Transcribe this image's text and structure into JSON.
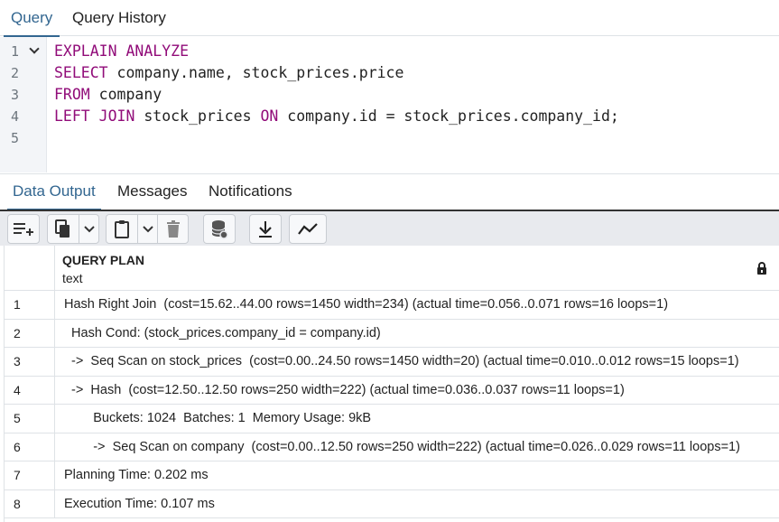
{
  "top_tabs": [
    {
      "label": "Query",
      "active": true
    },
    {
      "label": "Query History",
      "active": false
    }
  ],
  "editor": {
    "line_numbers": [
      "1",
      "2",
      "3",
      "4",
      "5"
    ],
    "lines": [
      [
        {
          "t": "EXPLAIN ANALYZE",
          "k": true
        }
      ],
      [
        {
          "t": "SELECT",
          "k": true
        },
        {
          "t": " company.name, stock_prices.price",
          "k": false
        }
      ],
      [
        {
          "t": "FROM",
          "k": true
        },
        {
          "t": " company",
          "k": false
        }
      ],
      [
        {
          "t": "LEFT JOIN",
          "k": true
        },
        {
          "t": " stock_prices ",
          "k": false
        },
        {
          "t": "ON",
          "k": true
        },
        {
          "t": " company.id = stock_prices.company_id;",
          "k": false
        }
      ],
      []
    ]
  },
  "output_tabs": [
    {
      "label": "Data Output",
      "active": true
    },
    {
      "label": "Messages",
      "active": false
    },
    {
      "label": "Notifications",
      "active": false
    }
  ],
  "toolbar": {
    "icons": [
      "add-row-icon",
      "copy-icon",
      "chevron-down-icon",
      "paste-icon",
      "chevron-down-icon",
      "delete-icon",
      "save-data-icon",
      "download-icon",
      "graph-icon"
    ]
  },
  "grid": {
    "column": {
      "name": "QUERY PLAN",
      "type": "text"
    },
    "rows": [
      {
        "n": "1",
        "v": "Hash Right Join  (cost=15.62..44.00 rows=1450 width=234) (actual time=0.056..0.071 rows=16 loops=1)"
      },
      {
        "n": "2",
        "v": "  Hash Cond: (stock_prices.company_id = company.id)"
      },
      {
        "n": "3",
        "v": "  ->  Seq Scan on stock_prices  (cost=0.00..24.50 rows=1450 width=20) (actual time=0.010..0.012 rows=15 loops=1)"
      },
      {
        "n": "4",
        "v": "  ->  Hash  (cost=12.50..12.50 rows=250 width=222) (actual time=0.036..0.037 rows=11 loops=1)"
      },
      {
        "n": "5",
        "v": "        Buckets: 1024  Batches: 1  Memory Usage: 9kB"
      },
      {
        "n": "6",
        "v": "        ->  Seq Scan on company  (cost=0.00..12.50 rows=250 width=222) (actual time=0.026..0.029 rows=11 loops=1)"
      },
      {
        "n": "7",
        "v": "Planning Time: 0.202 ms"
      },
      {
        "n": "8",
        "v": "Execution Time: 0.107 ms"
      }
    ]
  },
  "colors": {
    "accent": "#326690",
    "keyword": "#910c79"
  }
}
